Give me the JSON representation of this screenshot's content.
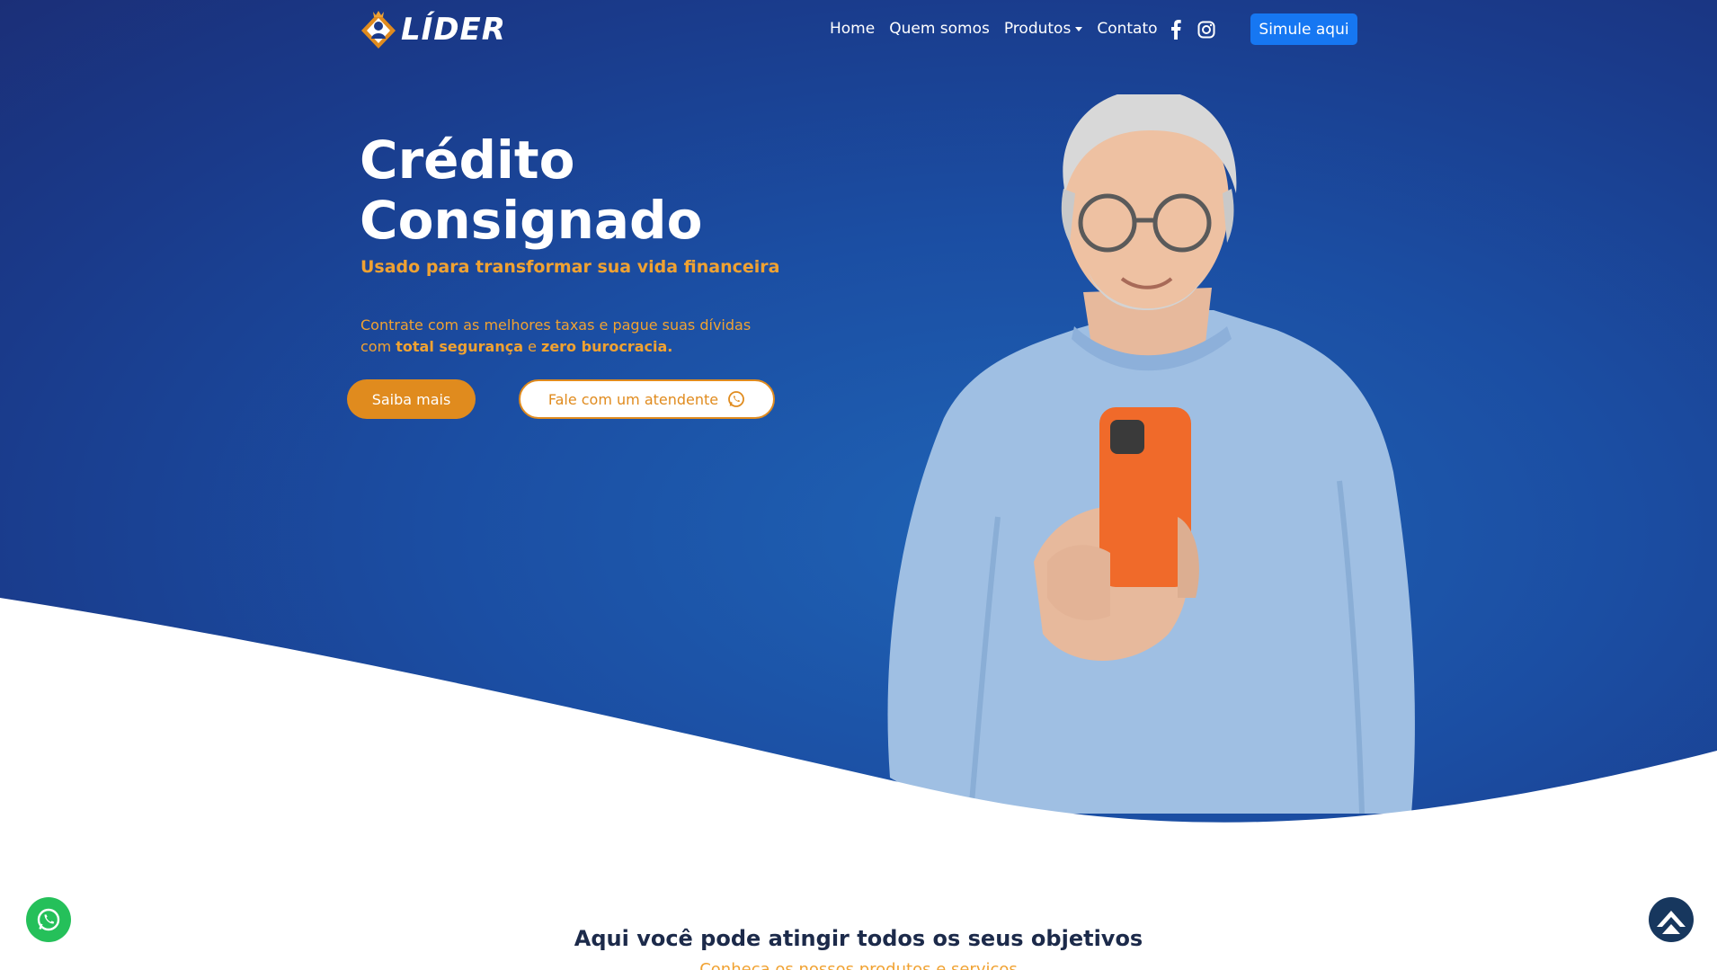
{
  "brand": {
    "name": "LÍDER"
  },
  "nav": {
    "links": [
      {
        "label": "Home"
      },
      {
        "label": "Quem somos"
      },
      {
        "label": "Produtos"
      },
      {
        "label": "Contato"
      }
    ],
    "cta_label": "Simule aqui",
    "social_icons": [
      "facebook-icon",
      "instagram-icon"
    ]
  },
  "hero": {
    "title_line1": "Crédito",
    "title_line2": "Consignado",
    "subtitle": "Usado para transformar sua vida financeira",
    "desc_part1": "Contrate com as melhores taxas e pague suas dívidas com ",
    "desc_bold1": "total segurança",
    "desc_part2": " e ",
    "desc_bold2": "zero burocracia.",
    "btn_primary": "Saiba mais",
    "btn_secondary": "Fale com um atendente"
  },
  "section": {
    "title": "Aqui você pode atingir todos os seus objetivos",
    "subtitle": "Conheça os nossos produtos e serviços"
  },
  "colors": {
    "hero_blue": "#1b4ea3",
    "accent_orange": "#e08b1e",
    "cta_blue": "#1677f2",
    "whatsapp_green": "#25c05a",
    "back_top_navy": "#17375e"
  }
}
